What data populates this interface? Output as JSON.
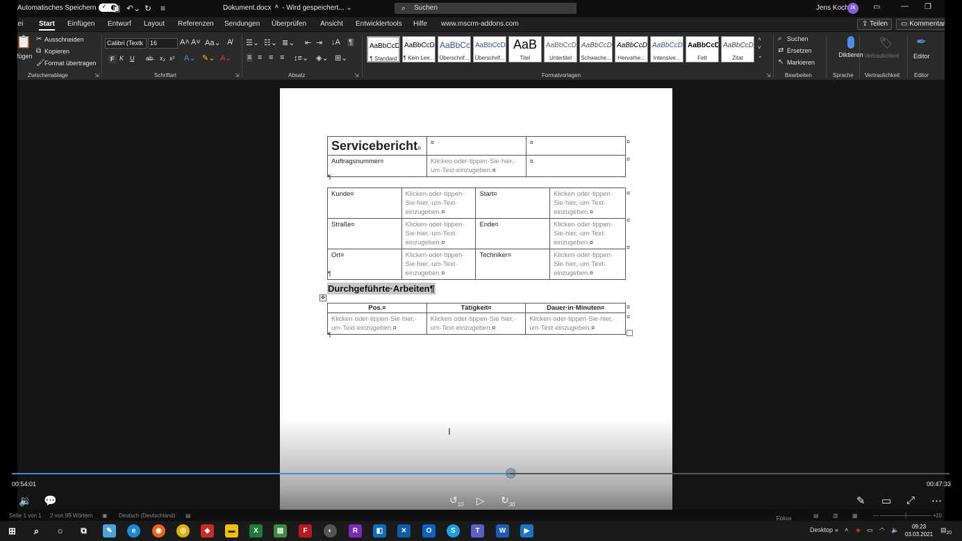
{
  "titlebar": {
    "autosave_label": "Automatisches Speichern",
    "doc_name": "Dokument.docx",
    "doc_status": "- Wird gespeichert... ⌄",
    "search_placeholder": "Suchen",
    "user_name": "Jens Koch",
    "user_initials": "JK"
  },
  "tabs": {
    "items": [
      "Datei",
      "Start",
      "Einfügen",
      "Entwurf",
      "Layout",
      "Referenzen",
      "Sendungen",
      "Überprüfen",
      "Ansicht",
      "Entwicklertools",
      "Hilfe",
      "www.mscrm-addons.com"
    ],
    "active": "Start",
    "share_label": "Teilen",
    "comments_label": "Kommentare"
  },
  "ribbon": {
    "clipboard": {
      "paste": "Einfügen",
      "cut": "Ausschneiden",
      "copy": "Kopieren",
      "format_painter": "Format übertragen",
      "label": "Zwischenablage"
    },
    "font": {
      "font_name": "Calibri (Textk",
      "font_size": "16",
      "bold": "F",
      "italic": "K",
      "underline": "U",
      "label": "Schriftart"
    },
    "paragraph": {
      "label": "Absatz"
    },
    "styles": {
      "label": "Formatvorlagen",
      "tiles": [
        {
          "sample": "AaBbCcDc",
          "name": "¶ Standard"
        },
        {
          "sample": "AaBbCcDc",
          "name": "¶ Kein Lee..."
        },
        {
          "sample": "AaBbCc",
          "name": "Überschrif..."
        },
        {
          "sample": "AaBbCcD",
          "name": "Überschrif..."
        },
        {
          "sample": "AaB",
          "name": "Titel"
        },
        {
          "sample": "AaBbCcD",
          "name": "Untertitel"
        },
        {
          "sample": "AaBbCcDc",
          "name": "Schwache..."
        },
        {
          "sample": "AaBbCcDc",
          "name": "Hervorhe..."
        },
        {
          "sample": "AaBbCcDc",
          "name": "Intensive..."
        },
        {
          "sample": "AaBbCcDc",
          "name": "Fett"
        },
        {
          "sample": "AaBbCcDc",
          "name": "Zitat"
        }
      ]
    },
    "editing": {
      "search": "Suchen",
      "replace": "Ersetzen",
      "select": "Markieren",
      "label": "Bearbeiten"
    },
    "voice": {
      "dictate": "Diktieren",
      "label": "Sprache"
    },
    "sensitivity": {
      "button": "Vertraulichkeit",
      "label": "Vertraulichkeit"
    },
    "editor": {
      "button": "Editor",
      "label": "Editor"
    }
  },
  "document": {
    "title": "Servicebericht",
    "cell_mark": "¤",
    "para_mark": "¶",
    "order_label": "Auftragsnummer",
    "placeholder": "Klicken·oder·tippen·Sie·hier,· um·Text·einzugeben.",
    "placeholder_narrow": "Klicken·oder·tippen· Sie·hier,·um·Text· einzugeben.",
    "details": [
      {
        "left_label": "Kunde",
        "right_label": "Start"
      },
      {
        "left_label": "Straße",
        "right_label": "Ende"
      },
      {
        "left_label": "Ort",
        "right_label": "Techniker"
      }
    ],
    "section_heading": "Durchgeführte·Arbeiten¶",
    "work_headers": [
      "Pos.",
      "Tätigkeit",
      "Dauer·in·Minuten"
    ]
  },
  "video": {
    "elapsed": "00:54:01",
    "remaining": "00:47:33",
    "progress": 0.532,
    "skip_back": "10",
    "skip_forward": "30"
  },
  "statusbar": {
    "page": "Seite 1 von 1",
    "words": "2 von 95 Wörtern",
    "language": "Deutsch (Deutschland)",
    "focus": "Fokus"
  },
  "taskbar": {
    "desktop": "Desktop",
    "time": "09:23",
    "date": "03.03.2021",
    "notifications": "20"
  }
}
